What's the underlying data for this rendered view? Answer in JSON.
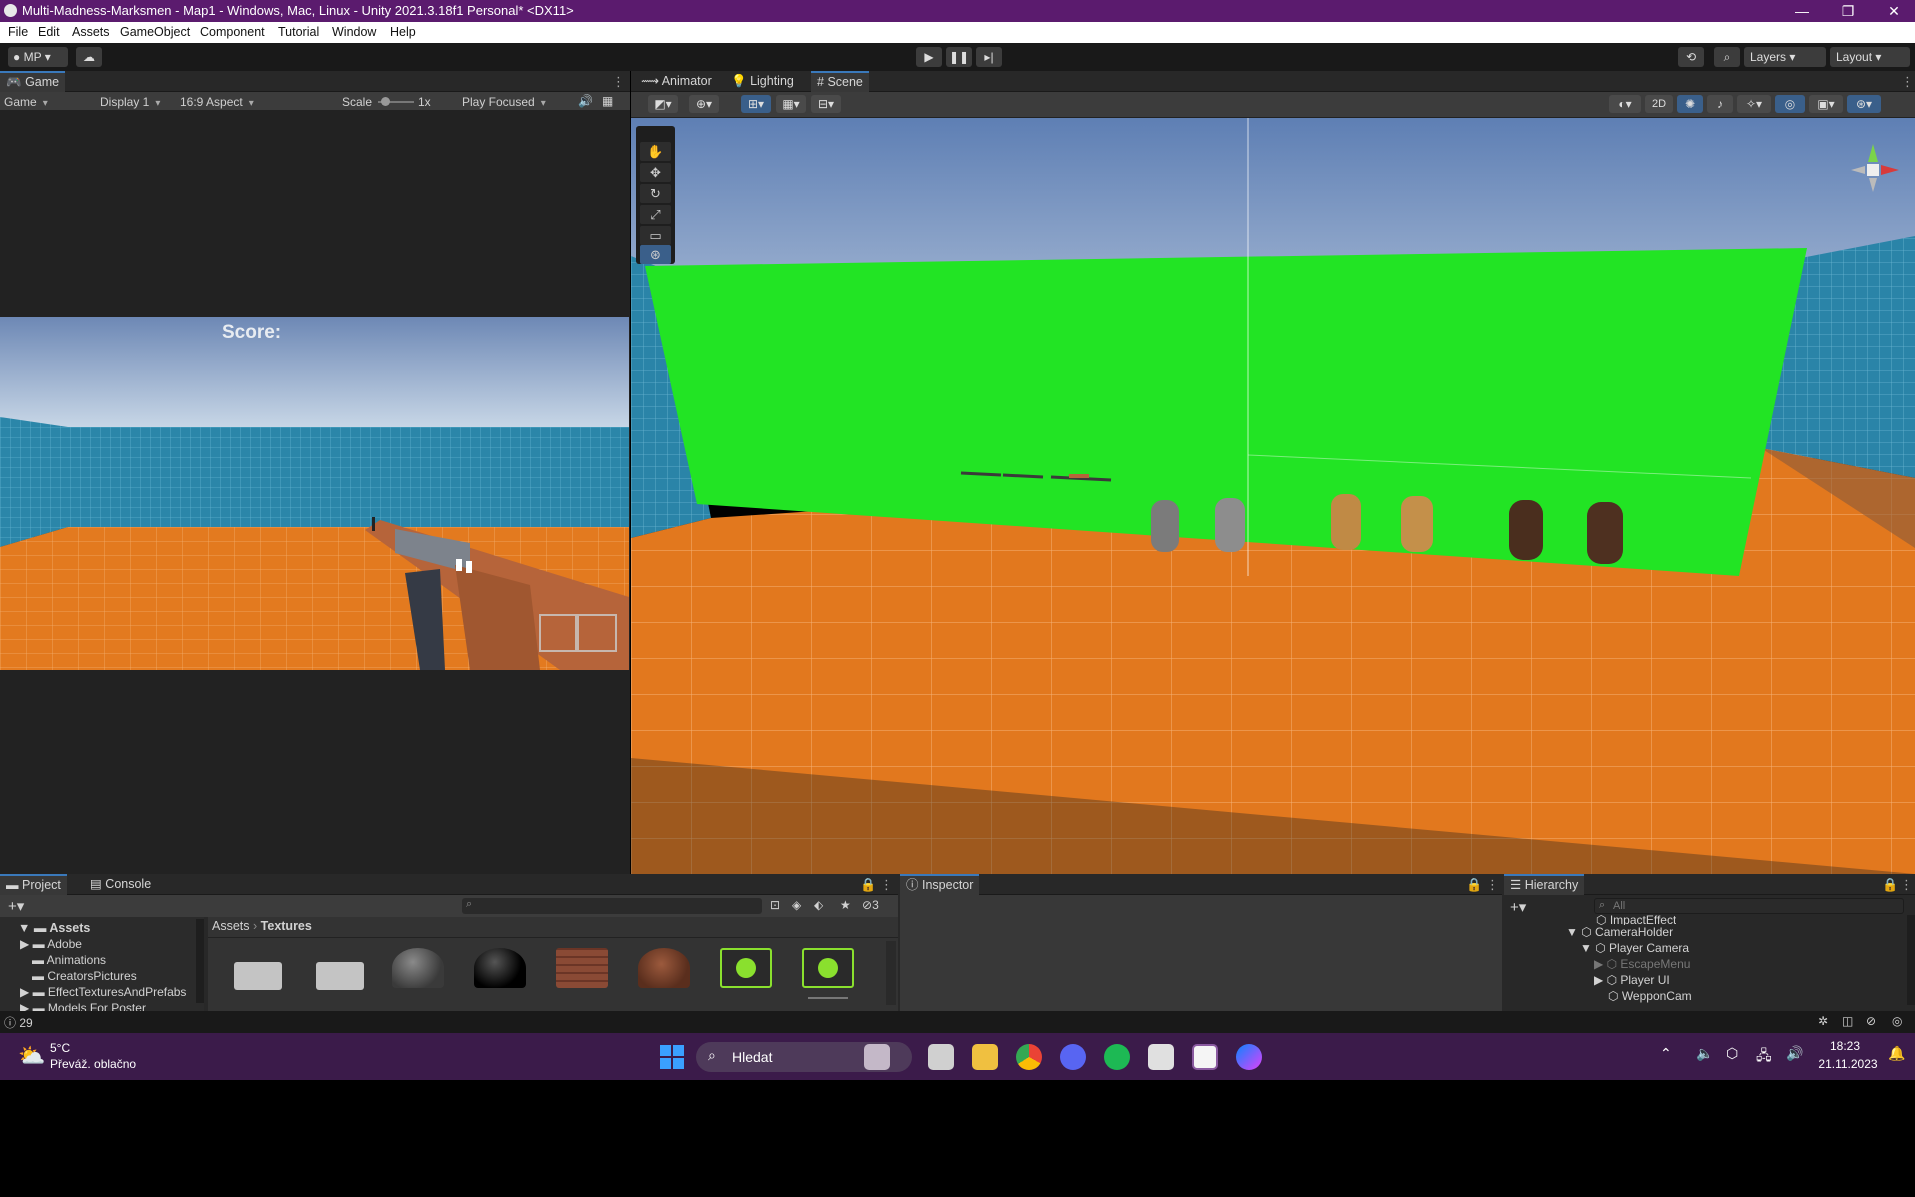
{
  "window": {
    "title": "Multi-Madness-Marksmen - Map1 - Windows, Mac, Linux - Unity 2021.3.18f1 Personal* <DX11>",
    "minimize": "—",
    "maximize": "❐",
    "close": "✕"
  },
  "menu": [
    "File",
    "Edit",
    "Assets",
    "GameObject",
    "Component",
    "Tutorial",
    "Window",
    "Help"
  ],
  "toolbar": {
    "account": "MP",
    "layers": "Layers",
    "layout": "Layout"
  },
  "game_panel": {
    "tab": "Game",
    "display_mode": "Game",
    "display": "Display 1",
    "aspect": "16:9 Aspect",
    "scale_label": "Scale",
    "scale_value": "1x",
    "play_mode": "Play Focused",
    "score_label": "Score:"
  },
  "scene_panel": {
    "tabs": [
      "Animator",
      "Lighting",
      "Scene"
    ],
    "mode_2d": "2D"
  },
  "project_panel": {
    "tabs": [
      "Project",
      "Console"
    ],
    "tree_root": "Assets",
    "tree_items": [
      "Adobe",
      "Animations",
      "CreatorsPictures",
      "EffectTexturesAndPrefabs",
      "Models For Poster"
    ],
    "breadcrumb": [
      "Assets",
      "Textures"
    ],
    "hidden_count": "3"
  },
  "inspector_panel": {
    "tab": "Inspector"
  },
  "hierarchy_panel": {
    "tab": "Hierarchy",
    "search_placeholder": "All",
    "items": [
      "ImpactEffect",
      "CameraHolder",
      "Player Camera",
      "EscapeMenu",
      "Player UI",
      "WepponCam"
    ]
  },
  "status": {
    "count": "29"
  },
  "taskbar": {
    "weather_temp": "5°C",
    "weather_desc": "Převáž. oblačno",
    "search": "Hledat",
    "time": "18:23",
    "date": "21.11.2023"
  },
  "colors": {
    "title_bar": "#5b1b6e",
    "taskbar": "#3b1b4a",
    "green_screen": "#22e424",
    "floor": "#e2781e",
    "wall": "#2a84a8"
  }
}
